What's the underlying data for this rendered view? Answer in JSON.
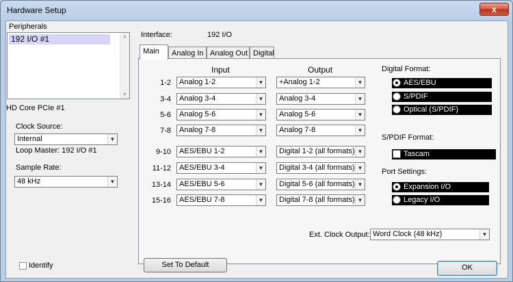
{
  "window": {
    "title": "Hardware Setup",
    "close_glyph": "x"
  },
  "left": {
    "peripherals_label": "Peripherals",
    "peripherals": [
      "192 I/O #1"
    ],
    "device": "HD Core PCIe #1",
    "clock_source_label": "Clock Source:",
    "clock_source_value": "Internal",
    "loop_master": "Loop Master:  192 I/O #1",
    "sample_rate_label": "Sample Rate:",
    "sample_rate_value": "48 kHz",
    "identify_label": "Identify"
  },
  "interface": {
    "label": "Interface:",
    "value": "192 I/O"
  },
  "tabs": [
    "Main",
    "Analog In",
    "Analog Out",
    "Digital"
  ],
  "main": {
    "input_header": "Input",
    "output_header": "Output",
    "rows": [
      {
        "ch": "1-2",
        "input": "Analog 1-2",
        "output": "+Analog 1-2"
      },
      {
        "ch": "3-4",
        "input": "Analog 3-4",
        "output": "Analog 3-4"
      },
      {
        "ch": "5-6",
        "input": "Analog 5-6",
        "output": "Analog 5-6"
      },
      {
        "ch": "7-8",
        "input": "Analog 7-8",
        "output": "Analog 7-8"
      },
      {
        "ch": "9-10",
        "input": "AES/EBU 1-2",
        "output": "Digital 1-2 (all formats)"
      },
      {
        "ch": "11-12",
        "input": "AES/EBU 3-4",
        "output": "Digital 3-4 (all formats)"
      },
      {
        "ch": "13-14",
        "input": "AES/EBU 5-6",
        "output": "Digital 5-6 (all formats)"
      },
      {
        "ch": "15-16",
        "input": "AES/EBU 7-8",
        "output": "Digital 7-8 (all formats)"
      }
    ],
    "digital_format_label": "Digital Format:",
    "digital_format_options": [
      "AES/EBU",
      "S/PDIF",
      "Optical (S/PDIF)"
    ],
    "spdif_format_label": "S/PDIF Format:",
    "tascam_label": "Tascam",
    "port_settings_label": "Port Settings:",
    "port_options": [
      "Expansion I/O",
      "Legacy I/O"
    ],
    "ext_clock_label": "Ext. Clock Output:",
    "ext_clock_value": "Word Clock (48 kHz)"
  },
  "buttons": {
    "default": "Set To Default",
    "ok": "OK"
  },
  "colors": {
    "list_selection": "#d8d4f8",
    "close_button": "#c7432b",
    "radio_bar": "#000000"
  }
}
